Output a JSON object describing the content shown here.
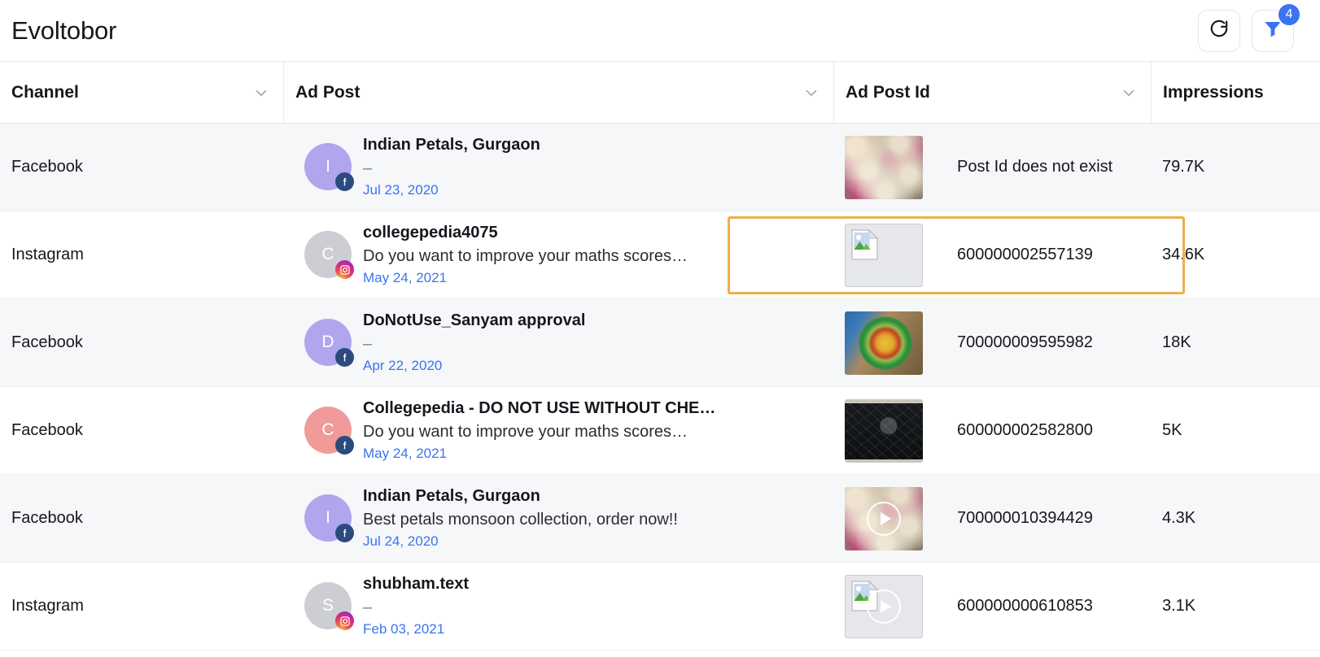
{
  "header": {
    "title": "Evoltobor",
    "refresh_label": "refresh",
    "filter_label": "filter",
    "filter_badge_count": "4"
  },
  "colors": {
    "accent_blue": "#3b74f2",
    "highlight_orange": "#efae4b",
    "date_link": "#3b74f2",
    "row_alt_bg": "#f6f7f9"
  },
  "table": {
    "columns": [
      {
        "label": "Channel",
        "sortable": true
      },
      {
        "label": "Ad Post",
        "sortable": true
      },
      {
        "label": "Ad Post Id",
        "sortable": true
      },
      {
        "label": "Impressions",
        "sortable": false
      }
    ],
    "rows": [
      {
        "channel": "Facebook",
        "avatar_letter": "I",
        "avatar_color": "#b0a6ee",
        "network": "facebook",
        "post_title": "Indian Petals, Gurgaon",
        "post_body": "–",
        "post_date": "Jul 23, 2020",
        "thumb_type": "flowers",
        "thumb_has_play": false,
        "ad_post_id": "Post Id does not exist",
        "impressions": "79.7K",
        "highlighted": false
      },
      {
        "channel": "Instagram",
        "avatar_letter": "C",
        "avatar_color": "#cdced3",
        "network": "instagram",
        "post_title": "collegepedia4075",
        "post_body": "Do you want to improve your maths scores…",
        "post_date": "May 24, 2021",
        "thumb_type": "broken",
        "thumb_has_play": false,
        "ad_post_id": "600000002557139",
        "impressions": "34.6K",
        "highlighted": true
      },
      {
        "channel": "Facebook",
        "avatar_letter": "D",
        "avatar_color": "#b0a6ee",
        "network": "facebook",
        "post_title": "DoNotUse_Sanyam approval",
        "post_body": "–",
        "post_date": "Apr 22, 2020",
        "thumb_type": "food",
        "thumb_has_play": false,
        "ad_post_id": "700000009595982",
        "impressions": "18K",
        "highlighted": false
      },
      {
        "channel": "Facebook",
        "avatar_letter": "C",
        "avatar_color": "#f09a9a",
        "network": "facebook",
        "post_title": "Collegepedia - DO NOT USE WITHOUT CHE…",
        "post_body": "Do you want to improve your maths scores…",
        "post_date": "May 24, 2021",
        "thumb_type": "chalk",
        "thumb_has_play": false,
        "ad_post_id": "600000002582800",
        "impressions": "5K",
        "highlighted": false
      },
      {
        "channel": "Facebook",
        "avatar_letter": "I",
        "avatar_color": "#b0a6ee",
        "network": "facebook",
        "post_title": "Indian Petals, Gurgaon",
        "post_body": "Best petals monsoon collection, order now!!",
        "post_date": "Jul 24, 2020",
        "thumb_type": "flowers",
        "thumb_has_play": true,
        "ad_post_id": "700000010394429",
        "impressions": "4.3K",
        "highlighted": false
      },
      {
        "channel": "Instagram",
        "avatar_letter": "S",
        "avatar_color": "#cdced3",
        "network": "instagram",
        "post_title": "shubham.text",
        "post_body": "–",
        "post_date": "Feb 03, 2021",
        "thumb_type": "broken",
        "thumb_has_play": true,
        "ad_post_id": "600000000610853",
        "impressions": "3.1K",
        "highlighted": false
      }
    ]
  }
}
